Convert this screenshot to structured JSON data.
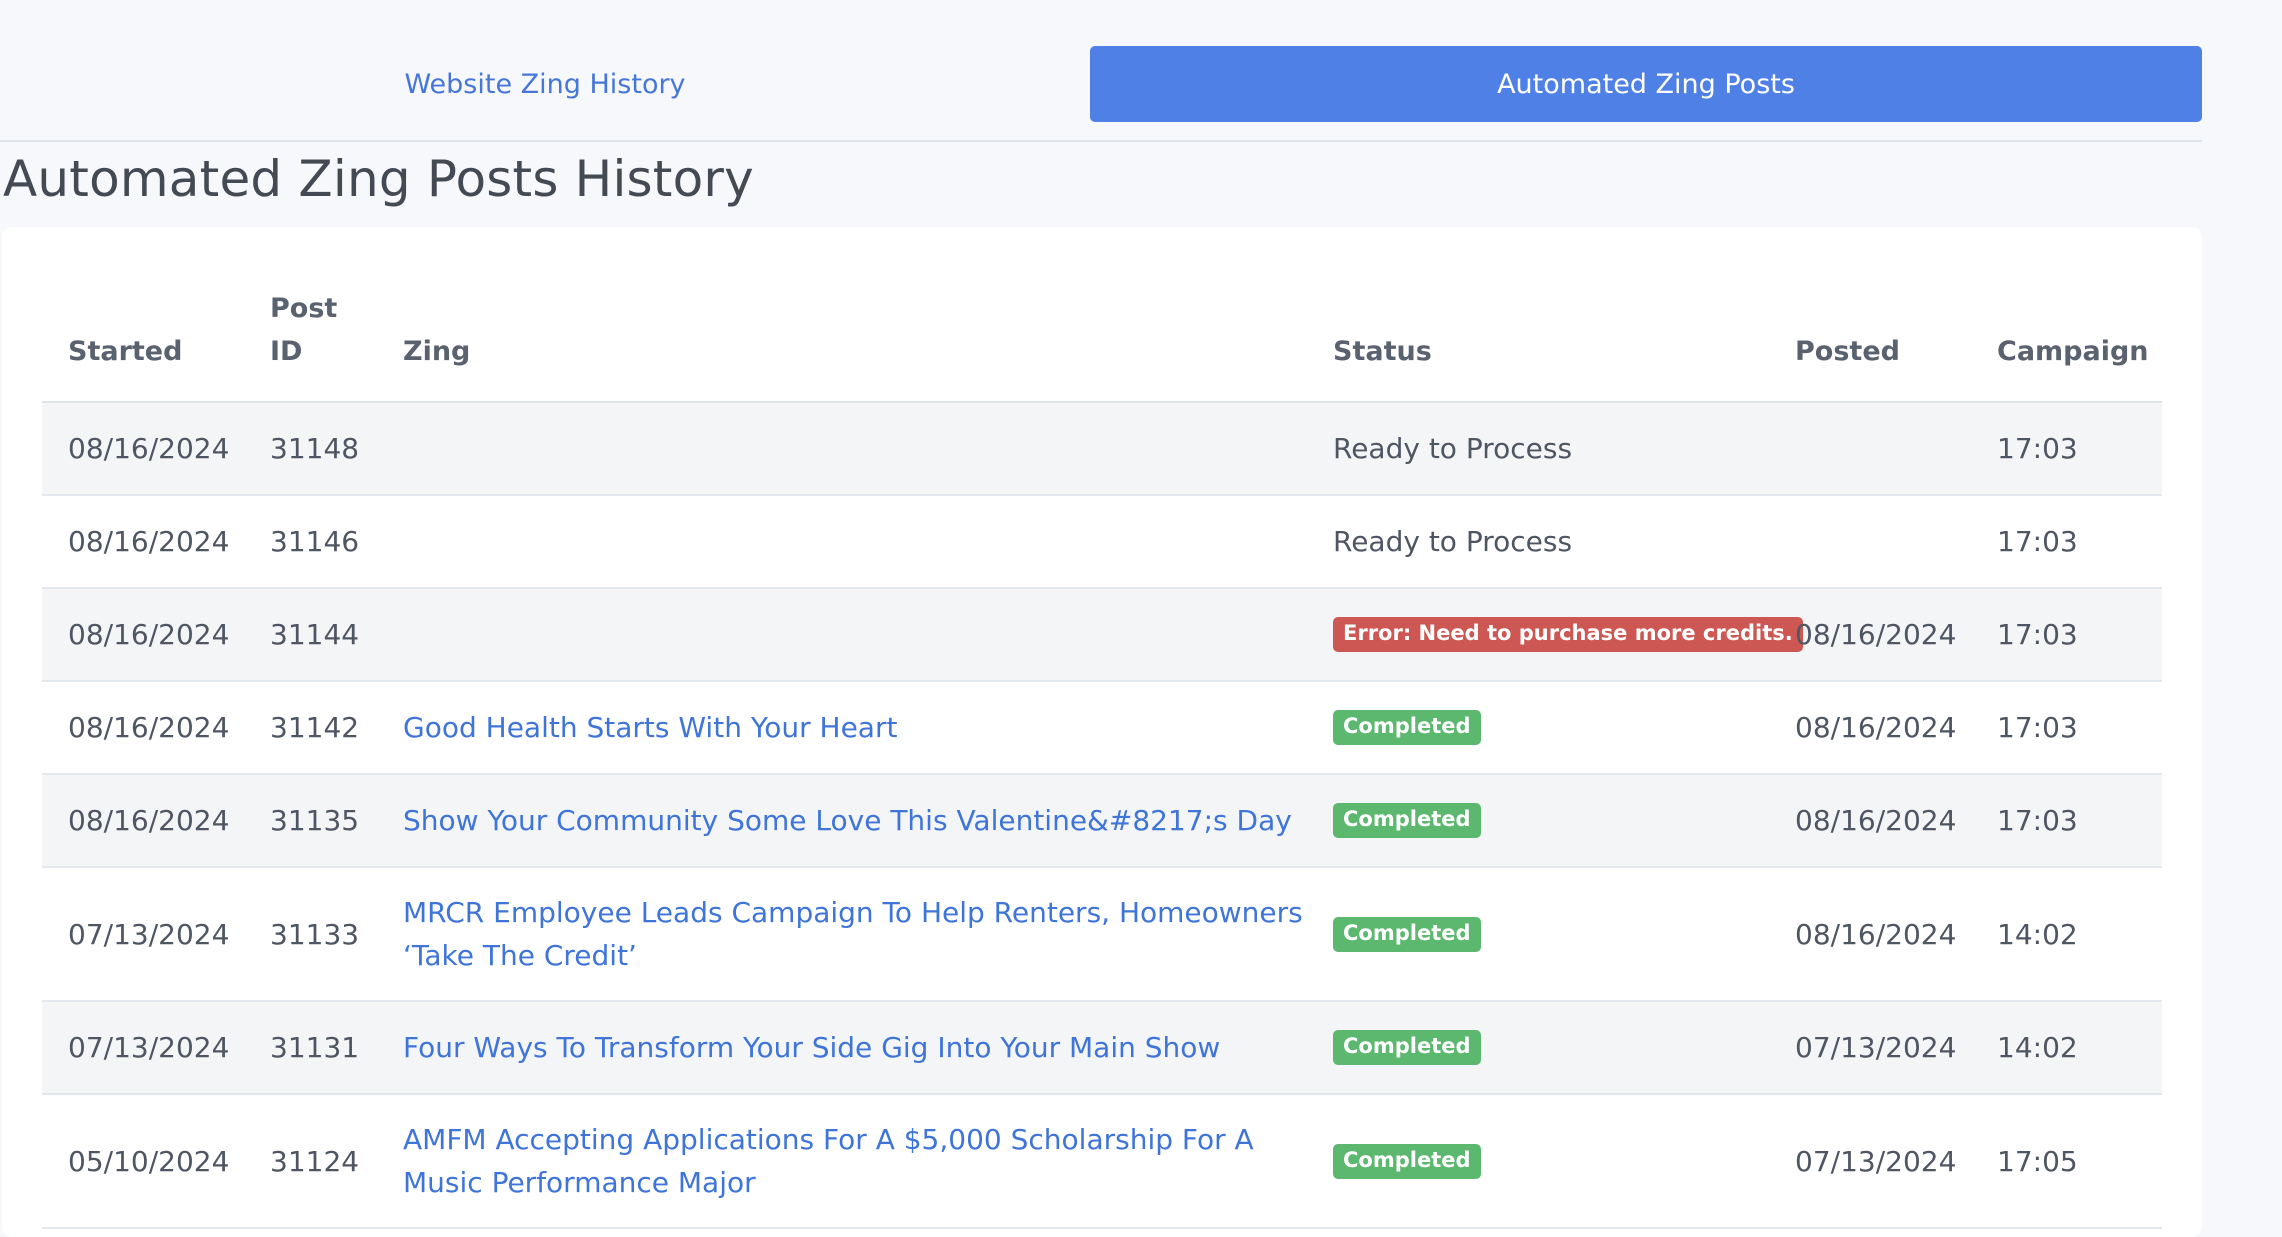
{
  "tabs": {
    "history_label": "Website Zing History",
    "auto_label": "Automated Zing Posts"
  },
  "page_title": "Automated Zing Posts History",
  "table": {
    "headers": {
      "started": "Started",
      "post_id": "Post ID",
      "zing": "Zing",
      "status": "Status",
      "posted": "Posted",
      "campaign": "Campaign"
    },
    "rows": [
      {
        "started": "08/16/2024",
        "post_id": "31148",
        "zing": "",
        "status": "Ready to Process",
        "posted": "",
        "campaign": "17:03"
      },
      {
        "started": "08/16/2024",
        "post_id": "31146",
        "zing": "",
        "status": "Ready to Process",
        "posted": "",
        "campaign": "17:03"
      },
      {
        "started": "08/16/2024",
        "post_id": "31144",
        "zing": "",
        "status": "Error: Need to purchase more credits.",
        "posted": "08/16/2024",
        "campaign": "17:03"
      },
      {
        "started": "08/16/2024",
        "post_id": "31142",
        "zing": "Good Health Starts With Your Heart",
        "status": "Completed",
        "posted": "08/16/2024",
        "campaign": "17:03"
      },
      {
        "started": "08/16/2024",
        "post_id": "31135",
        "zing": "Show Your Community Some Love This Valentine&#8217;s Day",
        "status": "Completed",
        "posted": "08/16/2024",
        "campaign": "17:03"
      },
      {
        "started": "07/13/2024",
        "post_id": "31133",
        "zing": "MRCR Employee Leads Campaign To Help Renters, Homeowners ‘Take The Credit’",
        "status": "Completed",
        "posted": "08/16/2024",
        "campaign": "14:02"
      },
      {
        "started": "07/13/2024",
        "post_id": "31131",
        "zing": "Four Ways To Transform Your Side Gig Into Your Main Show",
        "status": "Completed",
        "posted": "07/13/2024",
        "campaign": "14:02"
      },
      {
        "started": "05/10/2024",
        "post_id": "31124",
        "zing": "AMFM Accepting Applications For A $5,000 Scholarship For A Music Performance Major",
        "status": "Completed",
        "posted": "07/13/2024",
        "campaign": "17:05"
      }
    ]
  },
  "colors": {
    "accent": "#4e80e6",
    "link": "#3f74d8",
    "completed_badge": "#5cb86f",
    "error_badge": "#cd5752"
  }
}
